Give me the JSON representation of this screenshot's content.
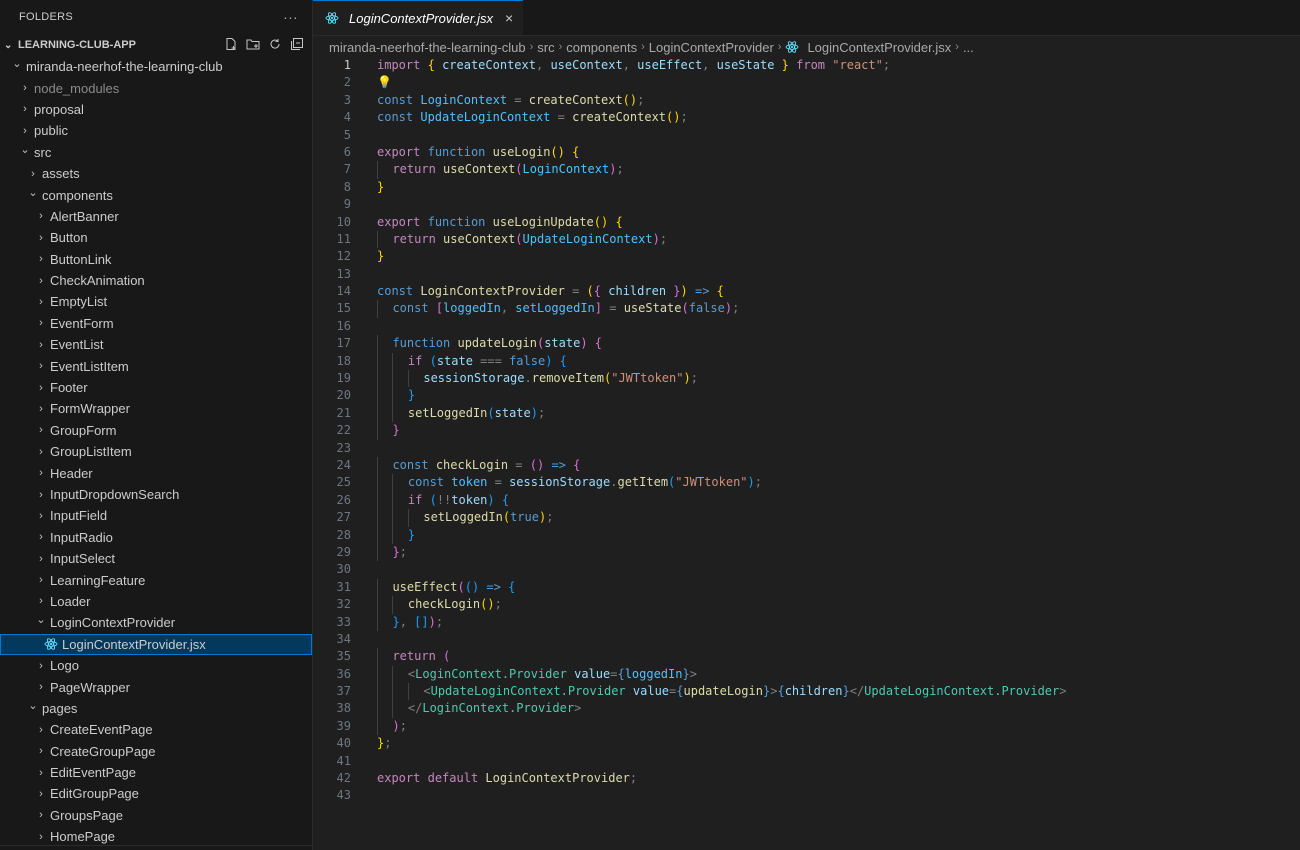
{
  "sidebar": {
    "header": "FOLDERS",
    "more": "···",
    "section": "LEARNING-CLUB-APP",
    "items": [
      {
        "label": "miranda-neerhof-the-learning-club",
        "depth": 1,
        "open": true
      },
      {
        "label": "node_modules",
        "depth": 2,
        "open": false,
        "muted": true
      },
      {
        "label": "proposal",
        "depth": 2,
        "open": false
      },
      {
        "label": "public",
        "depth": 2,
        "open": false
      },
      {
        "label": "src",
        "depth": 2,
        "open": true
      },
      {
        "label": "assets",
        "depth": 3,
        "open": false
      },
      {
        "label": "components",
        "depth": 3,
        "open": true
      },
      {
        "label": "AlertBanner",
        "depth": 4,
        "open": false
      },
      {
        "label": "Button",
        "depth": 4,
        "open": false
      },
      {
        "label": "ButtonLink",
        "depth": 4,
        "open": false
      },
      {
        "label": "CheckAnimation",
        "depth": 4,
        "open": false
      },
      {
        "label": "EmptyList",
        "depth": 4,
        "open": false
      },
      {
        "label": "EventForm",
        "depth": 4,
        "open": false
      },
      {
        "label": "EventList",
        "depth": 4,
        "open": false
      },
      {
        "label": "EventListItem",
        "depth": 4,
        "open": false
      },
      {
        "label": "Footer",
        "depth": 4,
        "open": false
      },
      {
        "label": "FormWrapper",
        "depth": 4,
        "open": false
      },
      {
        "label": "GroupForm",
        "depth": 4,
        "open": false
      },
      {
        "label": "GroupListItem",
        "depth": 4,
        "open": false
      },
      {
        "label": "Header",
        "depth": 4,
        "open": false
      },
      {
        "label": "InputDropdownSearch",
        "depth": 4,
        "open": false
      },
      {
        "label": "InputField",
        "depth": 4,
        "open": false
      },
      {
        "label": "InputRadio",
        "depth": 4,
        "open": false
      },
      {
        "label": "InputSelect",
        "depth": 4,
        "open": false
      },
      {
        "label": "LearningFeature",
        "depth": 4,
        "open": false
      },
      {
        "label": "Loader",
        "depth": 4,
        "open": false
      },
      {
        "label": "LoginContextProvider",
        "depth": 4,
        "open": true
      },
      {
        "label": "LoginContextProvider.jsx",
        "depth": 5,
        "file": true,
        "selected": true
      },
      {
        "label": "Logo",
        "depth": 4,
        "open": false
      },
      {
        "label": "PageWrapper",
        "depth": 4,
        "open": false
      },
      {
        "label": "pages",
        "depth": 3,
        "open": true
      },
      {
        "label": "CreateEventPage",
        "depth": 4,
        "open": false
      },
      {
        "label": "CreateGroupPage",
        "depth": 4,
        "open": false
      },
      {
        "label": "EditEventPage",
        "depth": 4,
        "open": false
      },
      {
        "label": "EditGroupPage",
        "depth": 4,
        "open": false
      },
      {
        "label": "GroupsPage",
        "depth": 4,
        "open": false
      },
      {
        "label": "HomePage",
        "depth": 4,
        "open": false
      }
    ]
  },
  "editor": {
    "tab_label": "LoginContextProvider.jsx",
    "tab_close": "×",
    "breadcrumb": [
      "miranda-neerhof-the-learning-club",
      "src",
      "components",
      "LoginContextProvider",
      "LoginContextProvider.jsx",
      "..."
    ],
    "active_line": 1
  },
  "code": [
    [
      [
        "kw",
        "import"
      ],
      [
        "pu",
        " "
      ],
      [
        "p1",
        "{"
      ],
      [
        "pu",
        " "
      ],
      [
        "vr",
        "createContext"
      ],
      [
        "pu",
        ", "
      ],
      [
        "vr",
        "useContext"
      ],
      [
        "pu",
        ", "
      ],
      [
        "vr",
        "useEffect"
      ],
      [
        "pu",
        ", "
      ],
      [
        "vr",
        "useState"
      ],
      [
        "pu",
        " "
      ],
      [
        "p1",
        "}"
      ],
      [
        "pu",
        " "
      ],
      [
        "kw",
        "from"
      ],
      [
        "pu",
        " "
      ],
      [
        "st",
        "\"react\""
      ],
      [
        "pu",
        ";"
      ]
    ],
    [
      [
        "bulb",
        "💡"
      ]
    ],
    [
      [
        "kd",
        "const"
      ],
      [
        "pu",
        " "
      ],
      [
        "cn",
        "LoginContext"
      ],
      [
        "pu",
        " = "
      ],
      [
        "fn",
        "createContext"
      ],
      [
        "p1",
        "()"
      ],
      [
        "pu",
        ";"
      ]
    ],
    [
      [
        "kd",
        "const"
      ],
      [
        "pu",
        " "
      ],
      [
        "cn",
        "UpdateLoginContext"
      ],
      [
        "pu",
        " = "
      ],
      [
        "fn",
        "createContext"
      ],
      [
        "p1",
        "()"
      ],
      [
        "pu",
        ";"
      ]
    ],
    [],
    [
      [
        "kw",
        "export"
      ],
      [
        "pu",
        " "
      ],
      [
        "kd",
        "function"
      ],
      [
        "pu",
        " "
      ],
      [
        "fn",
        "useLogin"
      ],
      [
        "p1",
        "()"
      ],
      [
        "pu",
        " "
      ],
      [
        "p1",
        "{"
      ]
    ],
    [
      [
        "g1",
        ""
      ],
      [
        "kw",
        "return"
      ],
      [
        "pu",
        " "
      ],
      [
        "fn",
        "useContext"
      ],
      [
        "p2",
        "("
      ],
      [
        "cn",
        "LoginContext"
      ],
      [
        "p2",
        ")"
      ],
      [
        "pu",
        ";"
      ]
    ],
    [
      [
        "p1",
        "}"
      ]
    ],
    [],
    [
      [
        "kw",
        "export"
      ],
      [
        "pu",
        " "
      ],
      [
        "kd",
        "function"
      ],
      [
        "pu",
        " "
      ],
      [
        "fn",
        "useLoginUpdate"
      ],
      [
        "p1",
        "()"
      ],
      [
        "pu",
        " "
      ],
      [
        "p1",
        "{"
      ]
    ],
    [
      [
        "g1",
        ""
      ],
      [
        "kw",
        "return"
      ],
      [
        "pu",
        " "
      ],
      [
        "fn",
        "useContext"
      ],
      [
        "p2",
        "("
      ],
      [
        "cn",
        "UpdateLoginContext"
      ],
      [
        "p2",
        ")"
      ],
      [
        "pu",
        ";"
      ]
    ],
    [
      [
        "p1",
        "}"
      ]
    ],
    [],
    [
      [
        "kd",
        "const"
      ],
      [
        "pu",
        " "
      ],
      [
        "fn",
        "LoginContextProvider"
      ],
      [
        "pu",
        " = "
      ],
      [
        "p1",
        "("
      ],
      [
        "p2",
        "{"
      ],
      [
        "pu",
        " "
      ],
      [
        "vr",
        "children"
      ],
      [
        "pu",
        " "
      ],
      [
        "p2",
        "}"
      ],
      [
        "p1",
        ")"
      ],
      [
        "pu",
        " "
      ],
      [
        "kd",
        "=>"
      ],
      [
        "pu",
        " "
      ],
      [
        "p1",
        "{"
      ]
    ],
    [
      [
        "g1",
        ""
      ],
      [
        "kd",
        "const"
      ],
      [
        "pu",
        " "
      ],
      [
        "p2",
        "["
      ],
      [
        "cn",
        "loggedIn"
      ],
      [
        "pu",
        ", "
      ],
      [
        "cn",
        "setLoggedIn"
      ],
      [
        "p2",
        "]"
      ],
      [
        "pu",
        " = "
      ],
      [
        "fn",
        "useState"
      ],
      [
        "p2",
        "("
      ],
      [
        "kd",
        "false"
      ],
      [
        "p2",
        ")"
      ],
      [
        "pu",
        ";"
      ]
    ],
    [],
    [
      [
        "g1",
        ""
      ],
      [
        "kd",
        "function"
      ],
      [
        "pu",
        " "
      ],
      [
        "fn",
        "updateLogin"
      ],
      [
        "p2",
        "("
      ],
      [
        "vr",
        "state"
      ],
      [
        "p2",
        ")"
      ],
      [
        "pu",
        " "
      ],
      [
        "p2",
        "{"
      ]
    ],
    [
      [
        "g2",
        ""
      ],
      [
        "kw",
        "if"
      ],
      [
        "pu",
        " "
      ],
      [
        "p3",
        "("
      ],
      [
        "vr",
        "state"
      ],
      [
        "pu",
        " === "
      ],
      [
        "kd",
        "false"
      ],
      [
        "p3",
        ")"
      ],
      [
        "pu",
        " "
      ],
      [
        "p3",
        "{"
      ]
    ],
    [
      [
        "g3",
        ""
      ],
      [
        "vr",
        "sessionStorage"
      ],
      [
        "pu",
        "."
      ],
      [
        "fn",
        "removeItem"
      ],
      [
        "p1",
        "("
      ],
      [
        "st",
        "\"JWTtoken\""
      ],
      [
        "p1",
        ")"
      ],
      [
        "pu",
        ";"
      ]
    ],
    [
      [
        "g2",
        ""
      ],
      [
        "p3",
        "}"
      ]
    ],
    [
      [
        "g2",
        ""
      ],
      [
        "fn",
        "setLoggedIn"
      ],
      [
        "p3",
        "("
      ],
      [
        "vr",
        "state"
      ],
      [
        "p3",
        ")"
      ],
      [
        "pu",
        ";"
      ]
    ],
    [
      [
        "g1",
        ""
      ],
      [
        "p2",
        "}"
      ]
    ],
    [],
    [
      [
        "g1",
        ""
      ],
      [
        "kd",
        "const"
      ],
      [
        "pu",
        " "
      ],
      [
        "fn",
        "checkLogin"
      ],
      [
        "pu",
        " = "
      ],
      [
        "p2",
        "()"
      ],
      [
        "pu",
        " "
      ],
      [
        "kd",
        "=>"
      ],
      [
        "pu",
        " "
      ],
      [
        "p2",
        "{"
      ]
    ],
    [
      [
        "g2",
        ""
      ],
      [
        "kd",
        "const"
      ],
      [
        "pu",
        " "
      ],
      [
        "cn",
        "token"
      ],
      [
        "pu",
        " = "
      ],
      [
        "vr",
        "sessionStorage"
      ],
      [
        "pu",
        "."
      ],
      [
        "fn",
        "getItem"
      ],
      [
        "p3",
        "("
      ],
      [
        "st",
        "\"JWTtoken\""
      ],
      [
        "p3",
        ")"
      ],
      [
        "pu",
        ";"
      ]
    ],
    [
      [
        "g2",
        ""
      ],
      [
        "kw",
        "if"
      ],
      [
        "pu",
        " "
      ],
      [
        "p3",
        "("
      ],
      [
        "pu",
        "!!"
      ],
      [
        "vr",
        "token"
      ],
      [
        "p3",
        ")"
      ],
      [
        "pu",
        " "
      ],
      [
        "p3",
        "{"
      ]
    ],
    [
      [
        "g3",
        ""
      ],
      [
        "fn",
        "setLoggedIn"
      ],
      [
        "p1",
        "("
      ],
      [
        "kd",
        "true"
      ],
      [
        "p1",
        ")"
      ],
      [
        "pu",
        ";"
      ]
    ],
    [
      [
        "g2",
        ""
      ],
      [
        "p3",
        "}"
      ]
    ],
    [
      [
        "g1",
        ""
      ],
      [
        "p2",
        "}"
      ],
      [
        "pu",
        ";"
      ]
    ],
    [],
    [
      [
        "g1",
        ""
      ],
      [
        "fn",
        "useEffect"
      ],
      [
        "p2",
        "("
      ],
      [
        "p3",
        "()"
      ],
      [
        "pu",
        " "
      ],
      [
        "kd",
        "=>"
      ],
      [
        "pu",
        " "
      ],
      [
        "p3",
        "{"
      ]
    ],
    [
      [
        "g2",
        ""
      ],
      [
        "fn",
        "checkLogin"
      ],
      [
        "p1",
        "()"
      ],
      [
        "pu",
        ";"
      ]
    ],
    [
      [
        "g1",
        ""
      ],
      [
        "p3",
        "}"
      ],
      [
        "pu",
        ", "
      ],
      [
        "p3",
        "[]"
      ],
      [
        "p2",
        ")"
      ],
      [
        "pu",
        ";"
      ]
    ],
    [],
    [
      [
        "g1",
        ""
      ],
      [
        "kw",
        "return"
      ],
      [
        "pu",
        " "
      ],
      [
        "p2",
        "("
      ]
    ],
    [
      [
        "g2",
        ""
      ],
      [
        "pu",
        "<"
      ],
      [
        "tg",
        "LoginContext.Provider"
      ],
      [
        "pu",
        " "
      ],
      [
        "vr",
        "value"
      ],
      [
        "pu",
        "="
      ],
      [
        "kd",
        "{"
      ],
      [
        "cn",
        "loggedIn"
      ],
      [
        "kd",
        "}"
      ],
      [
        "pu",
        ">"
      ]
    ],
    [
      [
        "g3",
        ""
      ],
      [
        "pu",
        "<"
      ],
      [
        "tg",
        "UpdateLoginContext.Provider"
      ],
      [
        "pu",
        " "
      ],
      [
        "vr",
        "value"
      ],
      [
        "pu",
        "="
      ],
      [
        "kd",
        "{"
      ],
      [
        "fn",
        "updateLogin"
      ],
      [
        "kd",
        "}"
      ],
      [
        "pu",
        ">"
      ],
      [
        "kd",
        "{"
      ],
      [
        "vr",
        "children"
      ],
      [
        "kd",
        "}"
      ],
      [
        "pu",
        "</"
      ],
      [
        "tg",
        "UpdateLoginContext.Provider"
      ],
      [
        "pu",
        ">"
      ]
    ],
    [
      [
        "g2",
        ""
      ],
      [
        "pu",
        "</"
      ],
      [
        "tg",
        "LoginContext.Provider"
      ],
      [
        "pu",
        ">"
      ]
    ],
    [
      [
        "g1",
        ""
      ],
      [
        "p2",
        ")"
      ],
      [
        "pu",
        ";"
      ]
    ],
    [
      [
        "p1",
        "}"
      ],
      [
        "pu",
        ";"
      ]
    ],
    [],
    [
      [
        "kw",
        "export"
      ],
      [
        "pu",
        " "
      ],
      [
        "kw",
        "default"
      ],
      [
        "pu",
        " "
      ],
      [
        "fn",
        "LoginContextProvider"
      ],
      [
        "pu",
        ";"
      ]
    ],
    []
  ]
}
